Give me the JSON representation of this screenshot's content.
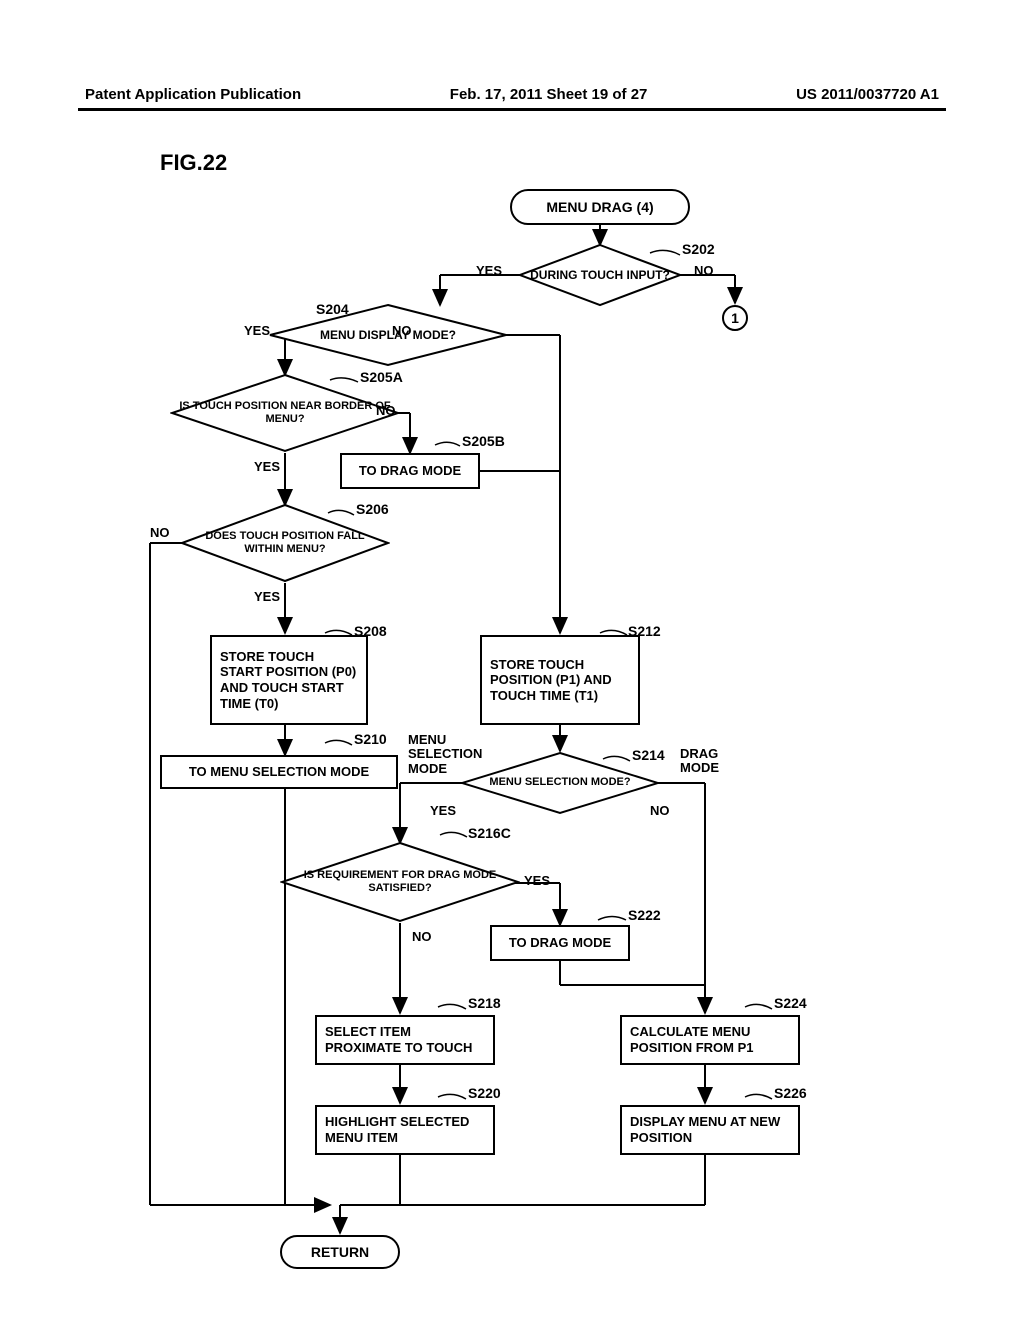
{
  "header": {
    "left": "Patent Application Publication",
    "center": "Feb. 17, 2011  Sheet 19 of 27",
    "right": "US 2011/0037720 A1"
  },
  "figure_label": "FIG.22",
  "chart_data": {
    "type": "flowchart",
    "title": "MENU DRAG (4)",
    "nodes": [
      {
        "id": "start",
        "type": "terminal",
        "text": "MENU DRAG (4)"
      },
      {
        "id": "s202",
        "type": "decision",
        "text": "DURING TOUCH INPUT?",
        "step": "S202"
      },
      {
        "id": "conn1",
        "type": "connector",
        "text": "1"
      },
      {
        "id": "s204",
        "type": "decision",
        "text": "MENU DISPLAY MODE?",
        "step": "S204"
      },
      {
        "id": "s205a",
        "type": "decision",
        "text": "IS TOUCH POSITION NEAR BORDER OF MENU?",
        "step": "S205A"
      },
      {
        "id": "s205b",
        "type": "process",
        "text": "TO DRAG MODE",
        "step": "S205B"
      },
      {
        "id": "s206",
        "type": "decision",
        "text": "DOES TOUCH POSITION FALL WITHIN MENU?",
        "step": "S206"
      },
      {
        "id": "s208",
        "type": "process",
        "text": "STORE TOUCH START POSITION (P0) AND TOUCH START TIME (T0)",
        "step": "S208"
      },
      {
        "id": "s212",
        "type": "process",
        "text": "STORE TOUCH POSITION (P1) AND TOUCH TIME (T1)",
        "step": "S212"
      },
      {
        "id": "s210",
        "type": "process",
        "text": "TO MENU SELECTION MODE",
        "step": "S210"
      },
      {
        "id": "s214",
        "type": "decision",
        "text": "MENU SELECTION MODE?",
        "step": "S214"
      },
      {
        "id": "s216c",
        "type": "decision",
        "text": "IS REQUIREMENT FOR DRAG MODE SATISFIED?",
        "step": "S216C"
      },
      {
        "id": "s222",
        "type": "process",
        "text": "TO DRAG MODE",
        "step": "S222"
      },
      {
        "id": "s218",
        "type": "process",
        "text": "SELECT ITEM PROXIMATE TO TOUCH",
        "step": "S218"
      },
      {
        "id": "s224",
        "type": "process",
        "text": "CALCULATE MENU POSITION FROM P1",
        "step": "S224"
      },
      {
        "id": "s220",
        "type": "process",
        "text": "HIGHLIGHT SELECTED MENU ITEM",
        "step": "S220"
      },
      {
        "id": "s226",
        "type": "process",
        "text": "DISPLAY MENU AT NEW POSITION",
        "step": "S226"
      },
      {
        "id": "return",
        "type": "terminal",
        "text": "RETURN"
      }
    ],
    "edges": [
      {
        "from": "start",
        "to": "s202"
      },
      {
        "from": "s202",
        "to": "s204",
        "label": "YES"
      },
      {
        "from": "s202",
        "to": "conn1",
        "label": "NO"
      },
      {
        "from": "s204",
        "to": "s205a",
        "label": "YES"
      },
      {
        "from": "s204",
        "to": "s212",
        "label": "NO"
      },
      {
        "from": "s205a",
        "to": "s206",
        "label": "YES"
      },
      {
        "from": "s205a",
        "to": "s205b",
        "label": "NO"
      },
      {
        "from": "s205b",
        "to": "s212"
      },
      {
        "from": "s206",
        "to": "s208",
        "label": "YES"
      },
      {
        "from": "s206",
        "to": "return",
        "label": "NO"
      },
      {
        "from": "s208",
        "to": "s210"
      },
      {
        "from": "s210",
        "to": "return"
      },
      {
        "from": "s212",
        "to": "s214"
      },
      {
        "from": "s214",
        "to": "s216c",
        "label": "YES",
        "note": "MENU SELECTION MODE"
      },
      {
        "from": "s214",
        "to": "s224",
        "label": "NO",
        "note": "DRAG MODE"
      },
      {
        "from": "s216c",
        "to": "s222",
        "label": "YES"
      },
      {
        "from": "s216c",
        "to": "s218",
        "label": "NO"
      },
      {
        "from": "s222",
        "to": "s224"
      },
      {
        "from": "s218",
        "to": "s220"
      },
      {
        "from": "s220",
        "to": "return"
      },
      {
        "from": "s224",
        "to": "s226"
      },
      {
        "from": "s226",
        "to": "return"
      }
    ]
  },
  "labels": {
    "yes": "YES",
    "no": "NO",
    "menu_selection_mode": "MENU SELECTION MODE",
    "drag_mode": "DRAG MODE"
  },
  "connector1": "1"
}
